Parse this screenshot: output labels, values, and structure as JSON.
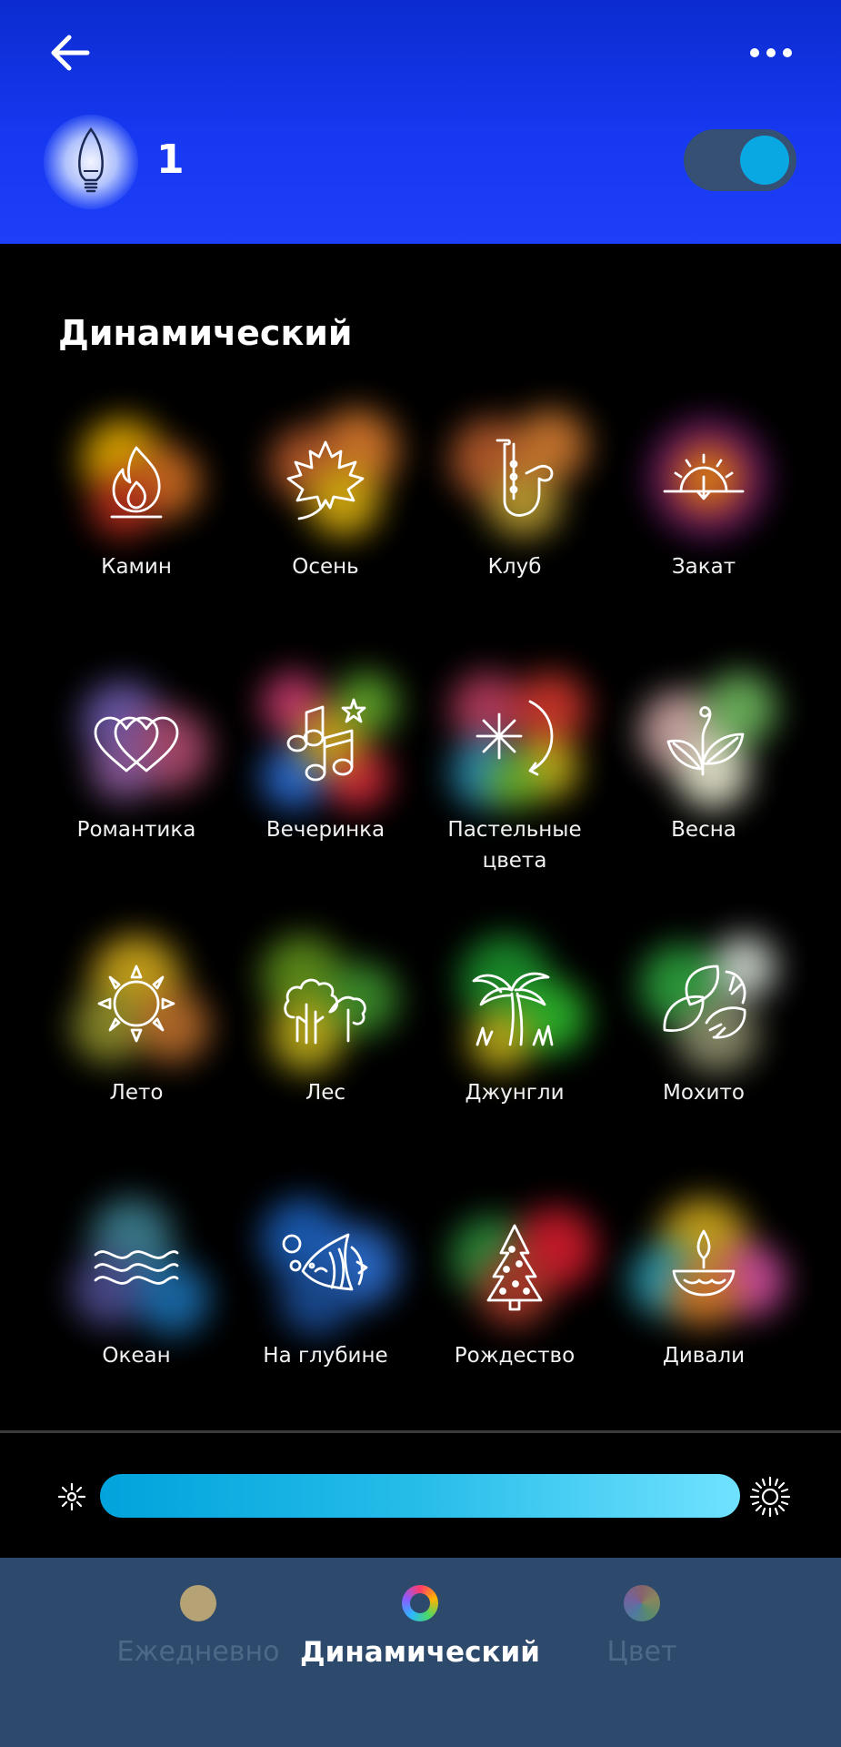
{
  "header": {
    "device_name": "1",
    "power_on": true,
    "back_icon": "arrow-left-icon",
    "more_icon": "more-horizontal-icon",
    "device_icon": "candle-bulb-icon"
  },
  "section": {
    "title": "Динамический"
  },
  "scenes": [
    {
      "label": "Камин",
      "icon": "fire-icon"
    },
    {
      "label": "Осень",
      "icon": "maple-leaf-icon"
    },
    {
      "label": "Клуб",
      "icon": "saxophone-icon"
    },
    {
      "label": "Закат",
      "icon": "sunset-icon"
    },
    {
      "label": "Романтика",
      "icon": "hearts-icon"
    },
    {
      "label": "Вечеринка",
      "icon": "music-notes-icon"
    },
    {
      "label": "Пастельные цвета",
      "icon": "pastel-icon"
    },
    {
      "label": "Весна",
      "icon": "sprout-icon"
    },
    {
      "label": "Лето",
      "icon": "sun-icon"
    },
    {
      "label": "Лес",
      "icon": "trees-icon"
    },
    {
      "label": "Джунгли",
      "icon": "palm-tree-icon"
    },
    {
      "label": "Мохито",
      "icon": "lime-mint-icon"
    },
    {
      "label": "Океан",
      "icon": "waves-icon"
    },
    {
      "label": "На глубине",
      "icon": "fish-icon"
    },
    {
      "label": "Рождество",
      "icon": "christmas-tree-icon"
    },
    {
      "label": "Дивали",
      "icon": "diya-lamp-icon"
    }
  ],
  "brightness": {
    "level": 1.0,
    "min_icon": "brightness-low-icon",
    "max_icon": "brightness-high-icon"
  },
  "tabs": [
    {
      "label": "Ежедневно",
      "active": false,
      "color": "#b5a376"
    },
    {
      "label": "Динамический",
      "active": true,
      "color": "#ffffff"
    },
    {
      "label": "Цвет",
      "active": false,
      "color": "#8a8ab0"
    }
  ],
  "colors": {
    "header_blue": "#1e3ff8",
    "accent_cyan": "#0aa8e2",
    "tab_bar": "#2d4a6c"
  }
}
